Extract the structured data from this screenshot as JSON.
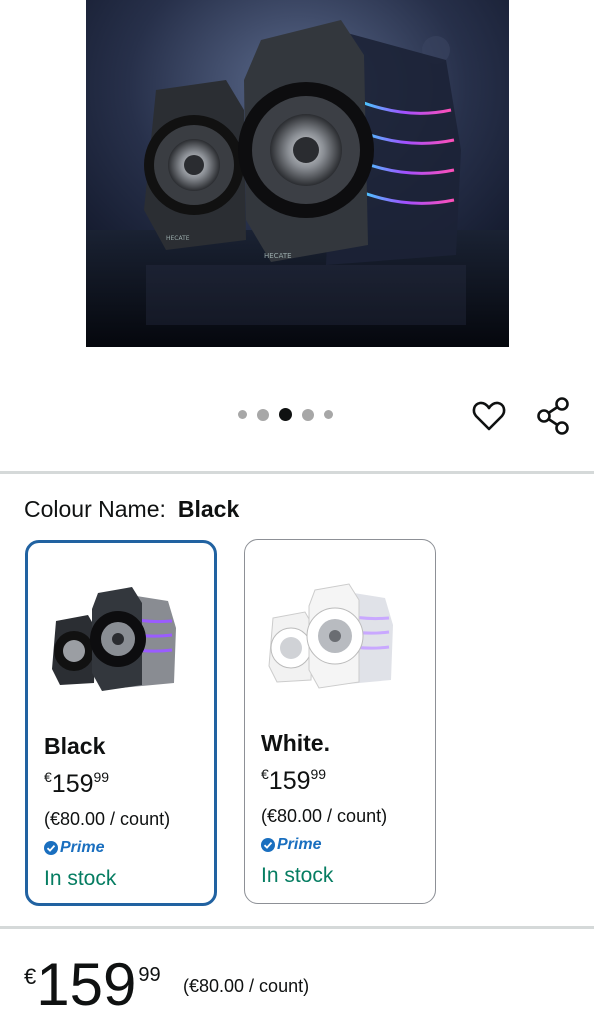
{
  "gallery": {
    "image_alt": "HECATE speakers",
    "speaker_brand": "HECATE",
    "dots_total": 5,
    "dots_active_index": 2
  },
  "actions": {
    "wishlist_icon": "heart-icon",
    "share_icon": "share-icon"
  },
  "colour": {
    "label": "Colour Name:",
    "selected": "Black"
  },
  "variants": [
    {
      "name": "Black",
      "currency": "€",
      "whole": "159",
      "fraction": "99",
      "unit_price": "(€80.00 / count)",
      "prime": "Prime",
      "stock": "In stock",
      "selected": true
    },
    {
      "name": "White.",
      "currency": "€",
      "whole": "159",
      "fraction": "99",
      "unit_price": "(€80.00 / count)",
      "prime": "Prime",
      "stock": "In stock",
      "selected": false
    }
  ],
  "price": {
    "currency": "€",
    "whole": "159",
    "fraction": "99",
    "unit_price": "(€80.00 / count)"
  },
  "colors": {
    "accent": "#2162a1",
    "stock": "#067d62",
    "prime": "#1a6fbf"
  }
}
